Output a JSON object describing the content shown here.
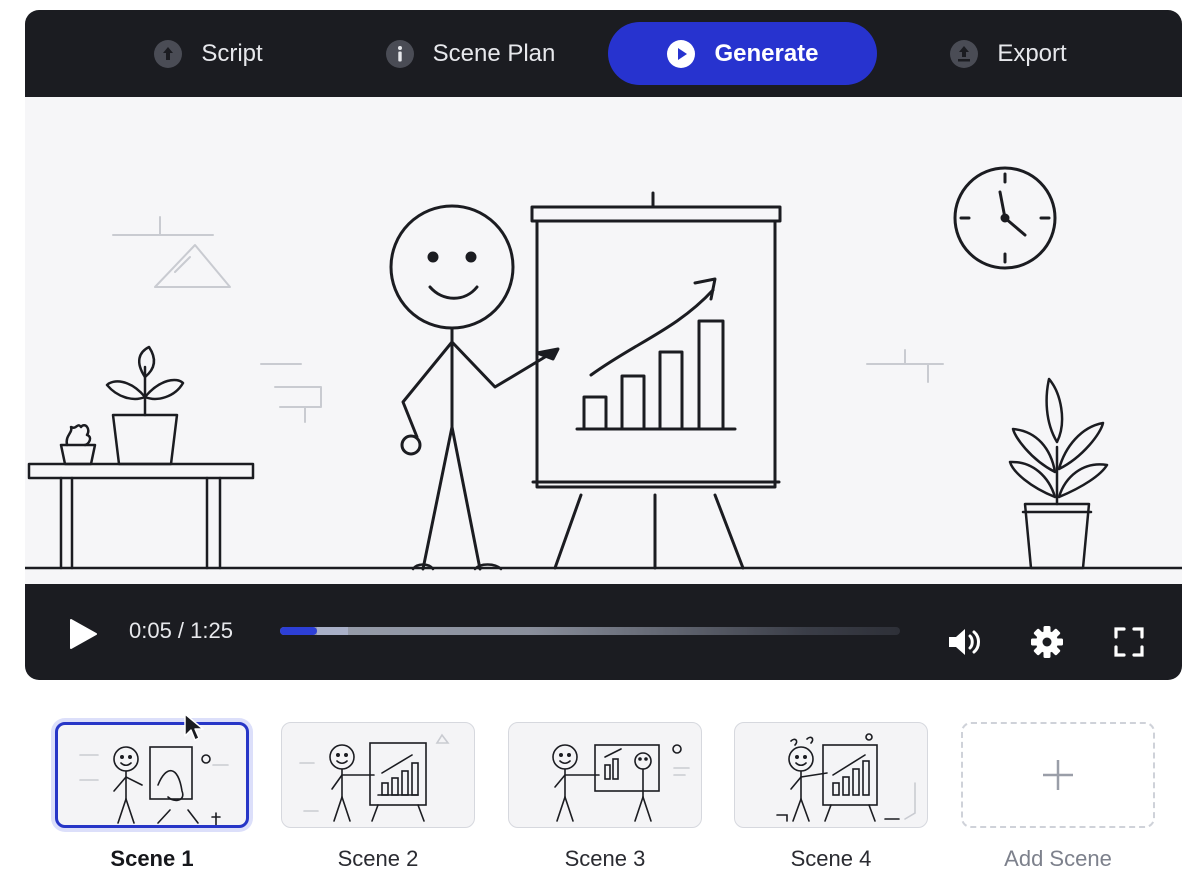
{
  "tabs": [
    {
      "label": "Script",
      "icon": "arrow-up-circle-icon"
    },
    {
      "label": "Scene Plan",
      "icon": "info-circle-icon"
    },
    {
      "label": "Generate",
      "icon": "play-circle-icon",
      "active": true
    },
    {
      "label": "Export",
      "icon": "upload-circle-icon"
    }
  ],
  "player": {
    "time_display": "0:05 / 1:25",
    "progress_percent": 6,
    "buffered_percent": 11
  },
  "scenes": [
    {
      "label": "Scene 1",
      "selected": true
    },
    {
      "label": "Scene 2"
    },
    {
      "label": "Scene 3"
    },
    {
      "label": "Scene 4"
    }
  ],
  "add_scene": {
    "label": "Add Scene",
    "icon": "plus-icon"
  },
  "colors": {
    "accent": "#2733cf",
    "dark_frame": "#1b1c21",
    "canvas_bg": "#f6f6f8"
  }
}
